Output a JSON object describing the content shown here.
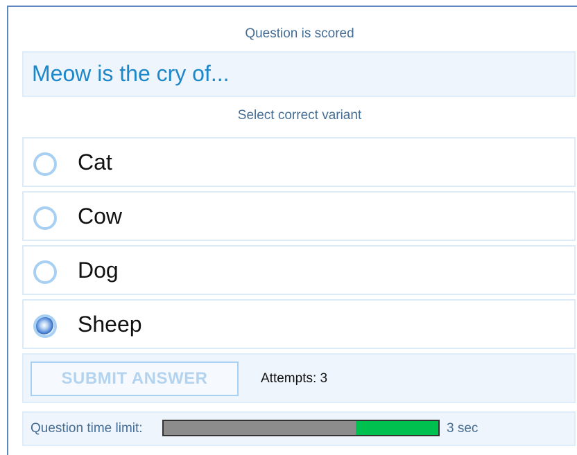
{
  "header": {
    "scored_text": "Question is scored"
  },
  "question": {
    "text": "Meow is the cry of..."
  },
  "instructions": "Select correct variant",
  "options": [
    {
      "label": "Cat",
      "selected": false
    },
    {
      "label": "Cow",
      "selected": false
    },
    {
      "label": "Dog",
      "selected": false
    },
    {
      "label": "Sheep",
      "selected": true
    }
  ],
  "submit": {
    "label": "SUBMIT ANSWER",
    "enabled": false
  },
  "attempts": {
    "text": "Attempts: 3"
  },
  "timer": {
    "label": "Question time limit:",
    "value_text": "3 sec",
    "remaining_fraction": 0.3
  },
  "colors": {
    "accent_text": "#1c87c9",
    "info_text": "#456d94",
    "timer_remaining": "#00c050",
    "timer_elapsed": "#8c8c8c"
  }
}
